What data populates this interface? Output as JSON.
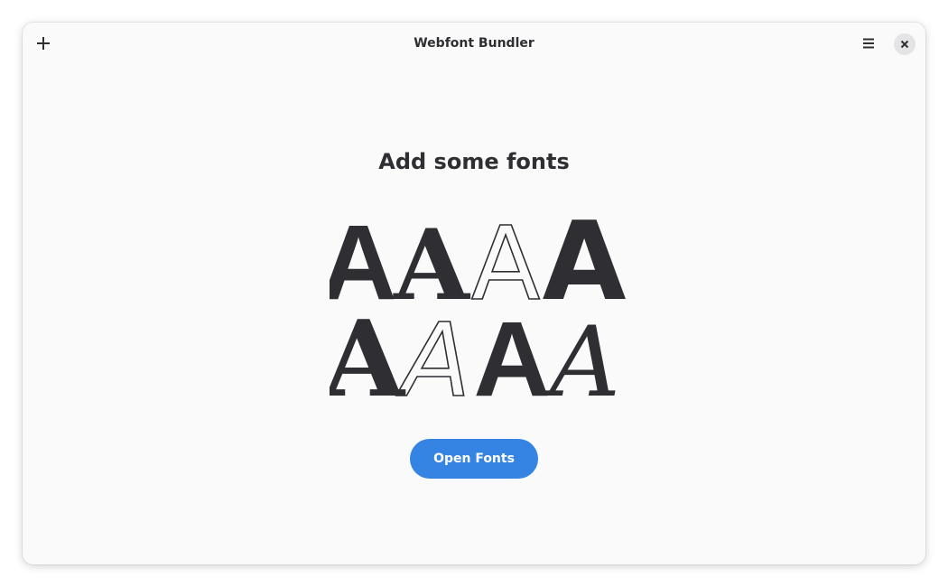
{
  "window": {
    "title": "Webfont Bundler"
  },
  "headerbar": {
    "add_icon": "plus-icon",
    "menu_icon": "hamburger-menu-icon",
    "close_icon": "close-icon"
  },
  "empty_state": {
    "heading": "Add some fonts",
    "illustration_glyph": "A",
    "open_button_label": "Open Fonts"
  },
  "colors": {
    "accent": "#3584e4",
    "text": "#2e2e33",
    "background": "#fafafa"
  }
}
